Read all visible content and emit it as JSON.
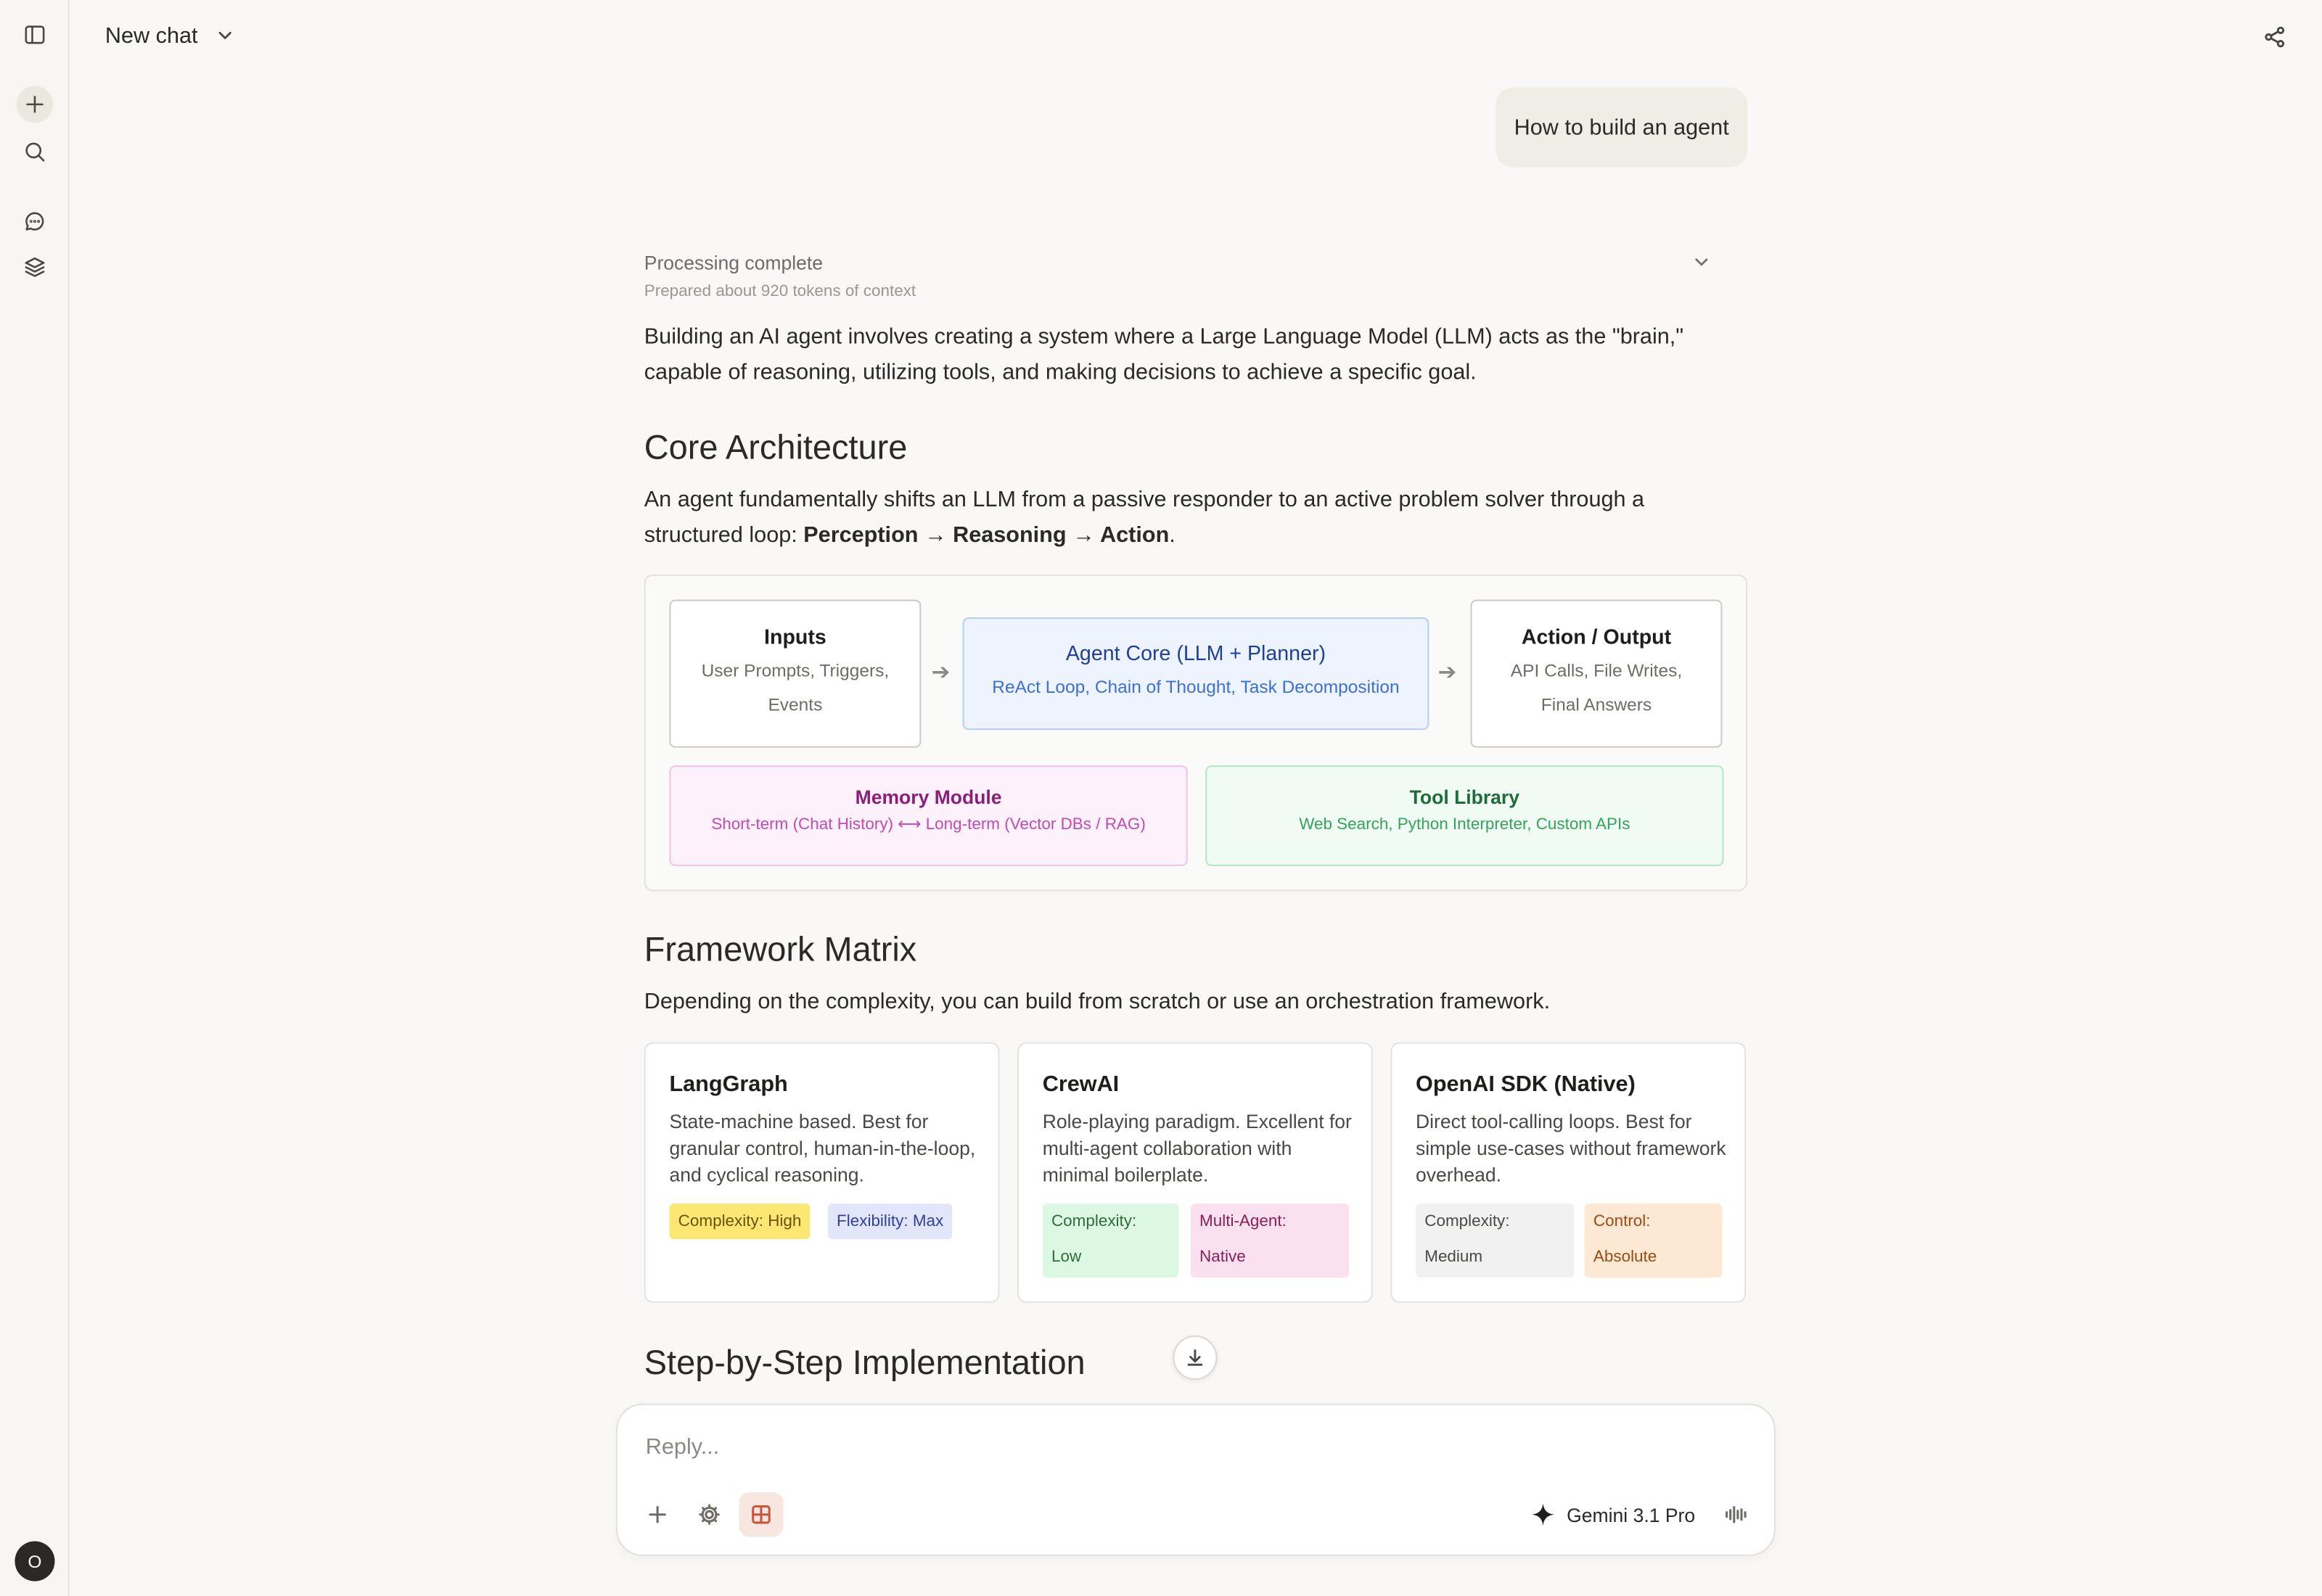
{
  "topbar": {
    "title": "New chat"
  },
  "user_message": "How to build an agent",
  "response": {
    "status_title": "Processing complete",
    "status_sub": "Prepared about 920 tokens of context",
    "intro_line1": "Building an AI agent involves creating a system where a Large Language Model (LLM) acts as the \"brain,\"",
    "intro_line2": "capable of reasoning, utilizing tools, and making decisions to achieve a specific goal.",
    "core": {
      "heading": "Core Architecture",
      "line1": "An agent fundamentally shifts an LLM from a passive responder to an active problem solver through a",
      "line2_prefix": "structured loop: ",
      "line2_bold": "Perception → Reasoning → Action",
      "line2_suffix": "."
    },
    "diagram": {
      "inputs": {
        "title": "Inputs",
        "desc1": "User Prompts, Triggers,",
        "desc2": "Events"
      },
      "core": {
        "title": "Agent Core (LLM + Planner)",
        "desc": "ReAct Loop, Chain of Thought, Task Decomposition"
      },
      "output": {
        "title": "Action / Output",
        "desc1": "API Calls, File Writes,",
        "desc2": "Final Answers"
      },
      "memory": {
        "title": "Memory Module",
        "desc": "Short-term (Chat History) ⟷ Long-term (Vector DBs / RAG)"
      },
      "tools": {
        "title": "Tool Library",
        "desc": "Web Search, Python Interpreter, Custom APIs"
      },
      "arrow": "➔"
    },
    "framework": {
      "heading": "Framework Matrix",
      "intro": "Depending on the complexity, you can build from scratch or use an orchestration framework.",
      "cards": [
        {
          "title": "LangGraph",
          "desc": "State-machine based. Best for granular control, human-in-the-loop, and cyclical reasoning.",
          "tag1": "Complexity: High",
          "tag2": "Flexibility: Max"
        },
        {
          "title": "CrewAI",
          "desc": "Role-playing paradigm. Excellent for multi-agent collaboration with minimal boilerplate.",
          "tag1a": "Complexity:",
          "tag1b": "Low",
          "tag2a": "Multi-Agent:",
          "tag2b": "Native"
        },
        {
          "title": "OpenAI SDK (Native)",
          "desc": "Direct tool-calling loops. Best for simple use-cases without framework overhead.",
          "tag1a": "Complexity:",
          "tag1b": "Medium",
          "tag2a": "Control:",
          "tag2b": "Absolute"
        }
      ]
    },
    "steps_heading": "Step-by-Step Implementation"
  },
  "composer": {
    "placeholder": "Reply...",
    "model": "Gemini 3.1 Pro"
  },
  "user": {
    "initial": "O"
  },
  "colors": {
    "background": "#f9f8f6",
    "core_blue": "#1f3f9a",
    "memory_purple": "#8a1f7a",
    "tool_green": "#1f6b3a"
  }
}
